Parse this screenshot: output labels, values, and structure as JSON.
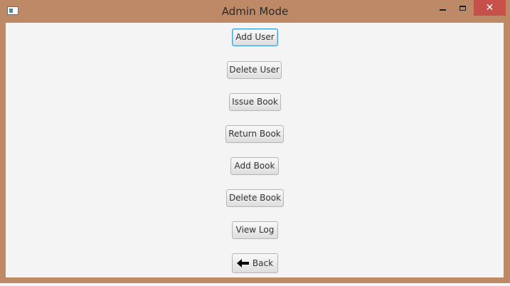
{
  "window": {
    "title": "Admin Mode",
    "close_glyph": "✕"
  },
  "buttons": {
    "add_user": "Add User",
    "delete_user": "Delete User",
    "issue_book": "Issue Book",
    "return_book": "Return Book",
    "add_book": "Add Book",
    "delete_book": "Delete Book",
    "view_log": "View Log",
    "back": "Back"
  },
  "icons": {
    "app": "app-window-icon",
    "back": "left-arrow-icon"
  },
  "colors": {
    "window_frame": "#bd8966",
    "close_button": "#c7504b",
    "focus_border": "#3d9fd4"
  }
}
